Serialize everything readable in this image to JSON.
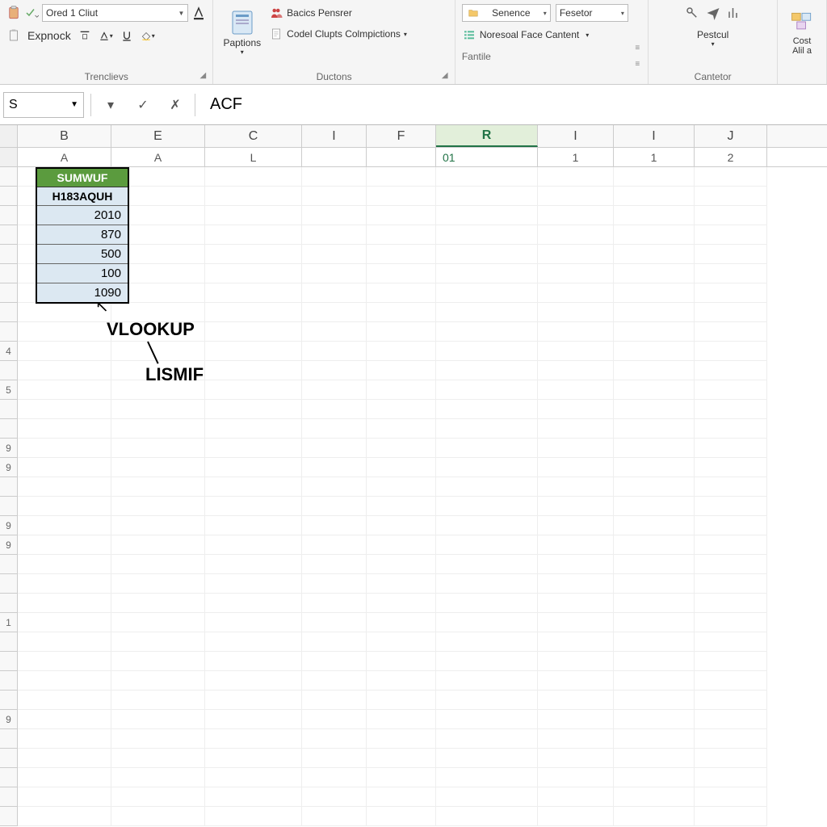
{
  "ribbon": {
    "group1": {
      "font_select": "Ored 1 Cliut",
      "row2_label": "Expnock",
      "label": "Trenclievs"
    },
    "group2": {
      "btn_paptions": "Paptions",
      "btn_bacics": "Bacics Pensrer",
      "btn_codel": "Codel Clupts Colmpictions",
      "label": "Ductons"
    },
    "group3": {
      "btn_senence": "Senence",
      "btn_fesetor": "Fesetor",
      "btn_noresoal": "Noresoal Face Cantent",
      "btn_fantile": "Fantile"
    },
    "group4": {
      "btn_pestcul": "Pestcul",
      "label": "Cantetor"
    },
    "group5": {
      "btn_cost": "Cost",
      "btn_alla": "Alil a"
    }
  },
  "formula_bar": {
    "name_box": "S",
    "formula": "ACF"
  },
  "columns": [
    "B",
    "E",
    "C",
    "I",
    "F",
    "R",
    "I",
    "I",
    "J"
  ],
  "sub_columns": [
    "A",
    "A",
    "L",
    "",
    "",
    "01",
    "",
    "1",
    "1",
    "2"
  ],
  "data_box": {
    "green_header": "SUMWUF",
    "bold_header": "H183AQUH",
    "values": [
      "2010",
      "870",
      "500",
      "100",
      "1090"
    ]
  },
  "annotations": {
    "vlookup": "VLOOKUP",
    "lismif": "LISMIF"
  },
  "row_labels": [
    "",
    "",
    "",
    "",
    "",
    "",
    "",
    "",
    "",
    "4",
    "",
    "5",
    "",
    "",
    "9",
    "9",
    "",
    "",
    "9",
    "9",
    "",
    "",
    "",
    "1",
    "",
    "",
    "",
    "",
    "9",
    ""
  ]
}
